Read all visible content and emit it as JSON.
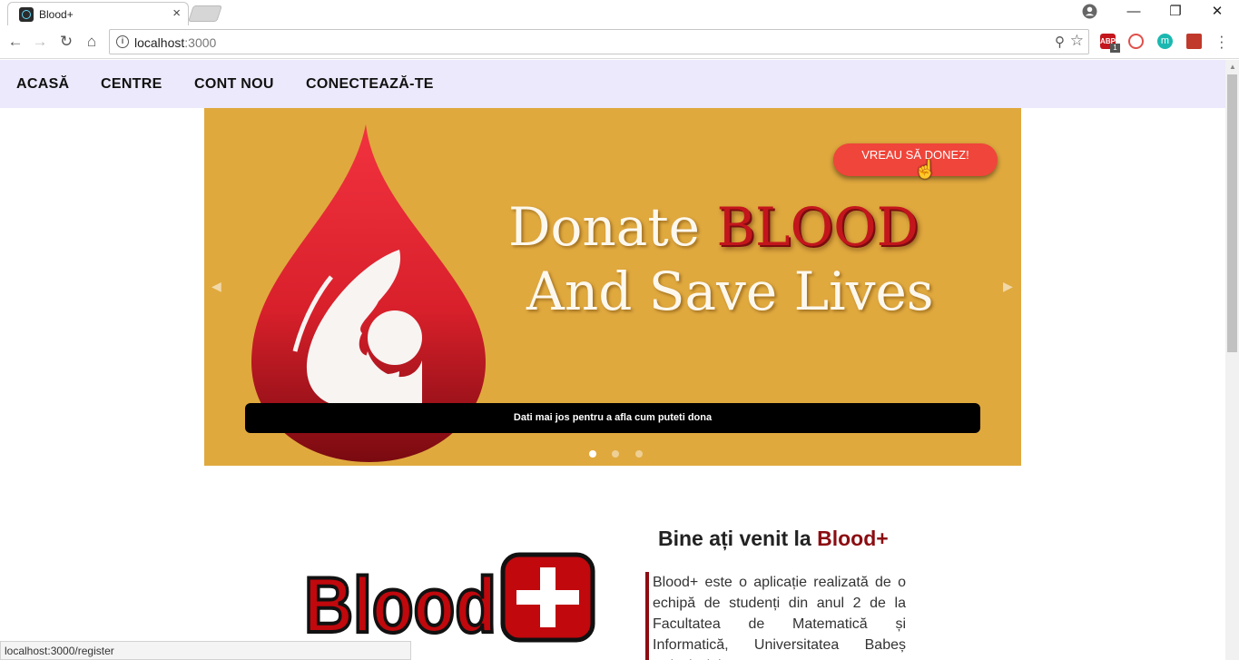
{
  "browser": {
    "tab_title": "Blood+",
    "tab_close": "×",
    "url_host": "localhost",
    "url_port": ":3000",
    "extension_abp_label": "ABP",
    "extension_abp_badge": "1",
    "extension_m_label": "m",
    "window_min": "—",
    "window_max": "❐",
    "window_close": "✕",
    "status_url": "localhost:3000/register",
    "icons": [
      "back-arrow-icon",
      "forward-arrow-icon",
      "reload-icon",
      "home-icon",
      "info-icon",
      "zoom-icon",
      "star-icon",
      "menu-icon"
    ]
  },
  "nav": {
    "items": [
      {
        "label": "ACASĂ"
      },
      {
        "label": "CENTRE"
      },
      {
        "label": "CONT NOU"
      },
      {
        "label": "CONECTEAZĂ-TE"
      }
    ]
  },
  "hero": {
    "headline_word_1": "Donate",
    "headline_word_2": "BLOOD",
    "headline_line_2": "And Save Lives",
    "donate_button": "VREAU SĂ DONEZ!",
    "caption": "Dati mai jos pentru a afla cum puteti dona",
    "slide_count": 3,
    "active_slide": 1,
    "colors": {
      "background": "#e0a93e",
      "button": "#f0453a",
      "drop": "#d8202b"
    }
  },
  "welcome": {
    "title_prefix": "Bine ați venit la",
    "title_brand": "Blood+",
    "text": "Blood+ este o aplicație realizată de o echipă de studenți din anul 2 de la Facultatea de Matematică și Informatică, Universitatea Babeș Bolyai Cluj-Napoca",
    "logo_text": "Blood",
    "brand_color": "#8b0d12"
  }
}
